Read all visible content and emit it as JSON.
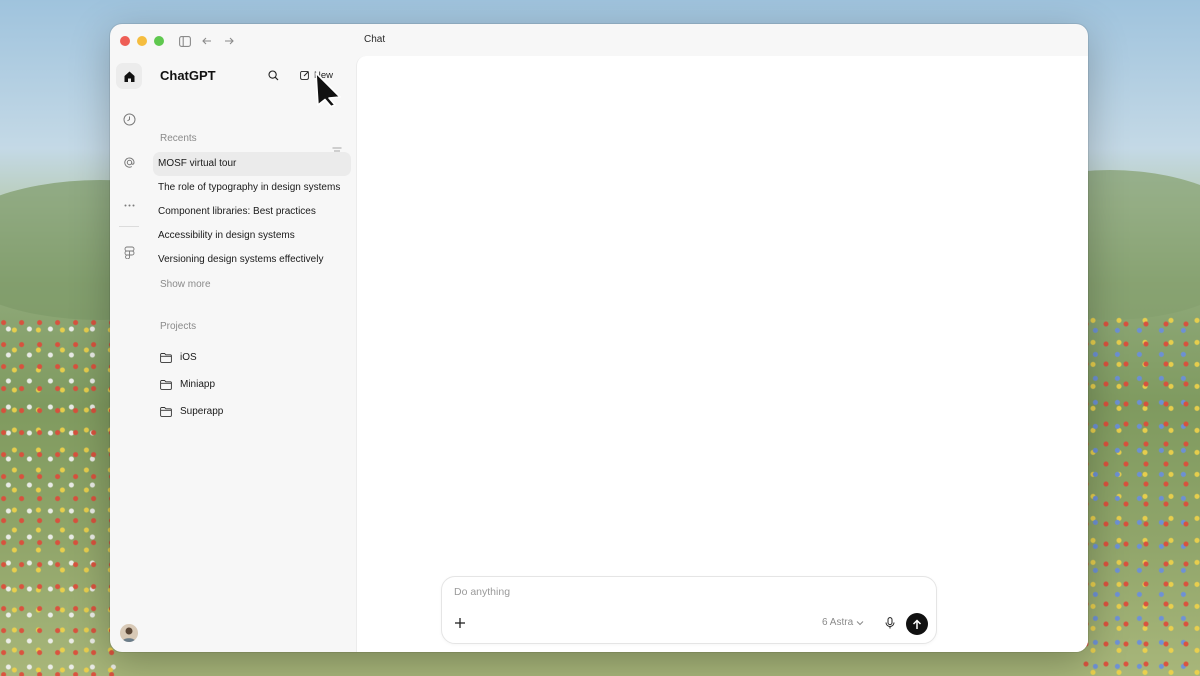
{
  "window": {
    "title": "Chat"
  },
  "sidebar": {
    "app_name": "ChatGPT",
    "new_label": "New",
    "recents_label": "Recents",
    "recents": [
      "MOSF virtual tour",
      "The role of typography in design systems",
      "Component libraries: Best practices",
      "Accessibility in design systems",
      "Versioning design systems effectively"
    ],
    "show_more_label": "Show more",
    "projects_label": "Projects",
    "projects": [
      "iOS",
      "Miniapp",
      "Superapp"
    ]
  },
  "rail": {
    "icons": [
      "home-icon",
      "clock-icon",
      "at-icon",
      "more-icon",
      "figma-icon"
    ]
  },
  "composer": {
    "placeholder": "Do anything",
    "model": "6 Astra"
  },
  "colors": {
    "close": "#ee5e56",
    "minimize": "#f5bd3f",
    "zoom": "#5fc84f",
    "send": "#111111"
  }
}
